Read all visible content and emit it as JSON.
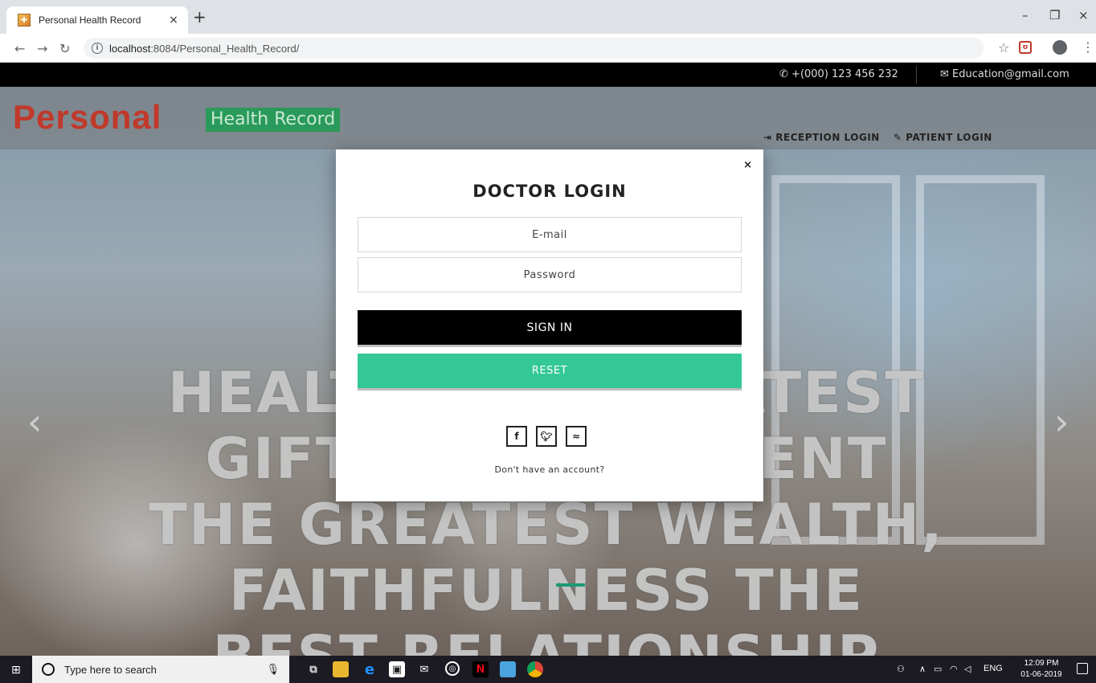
{
  "browser": {
    "tab_title": "Personal Health Record",
    "tab_close": "×",
    "new_tab": "+",
    "url_host": "localhost",
    "url_rest": ":8084/Personal_Health_Record/",
    "window_minimize": "–",
    "window_maximize": "❐",
    "window_close": "×"
  },
  "topbar": {
    "phone_icon": "phone-icon",
    "phone": "+(000) 123 456 232",
    "email_icon": "envelope-icon",
    "email": "Education@gmail.com"
  },
  "brand": {
    "personal": "Personal",
    "health_record": "Health Record"
  },
  "nav": {
    "reception_login": "RECEPTION LOGIN",
    "patient_login": "PATIENT LOGIN"
  },
  "hero": {
    "text": "HEALTH THE GREATEST GIFT, CONTENTMENT THE GREATEST WEALTH, FAITHFULNESS THE BEST RELATIONSHIP",
    "prev": "‹",
    "next": "›"
  },
  "modal": {
    "close": "×",
    "title": "DOCTOR LOGIN",
    "email_placeholder": "E-mail",
    "password_placeholder": "Password",
    "signin_label": "SIGN IN",
    "reset_label": "RESET",
    "social": [
      "f",
      "t",
      "rss"
    ],
    "no_account": "Don't have an account?"
  },
  "taskbar": {
    "search_placeholder": "Type here to search",
    "lang": "ENG",
    "time": "12:09 PM",
    "date": "01-06-2019"
  },
  "colors": {
    "brand_red": "#c0392b",
    "brand_green": "#2a9a5a",
    "reset_green": "#33c896",
    "signin_black": "#000000"
  }
}
